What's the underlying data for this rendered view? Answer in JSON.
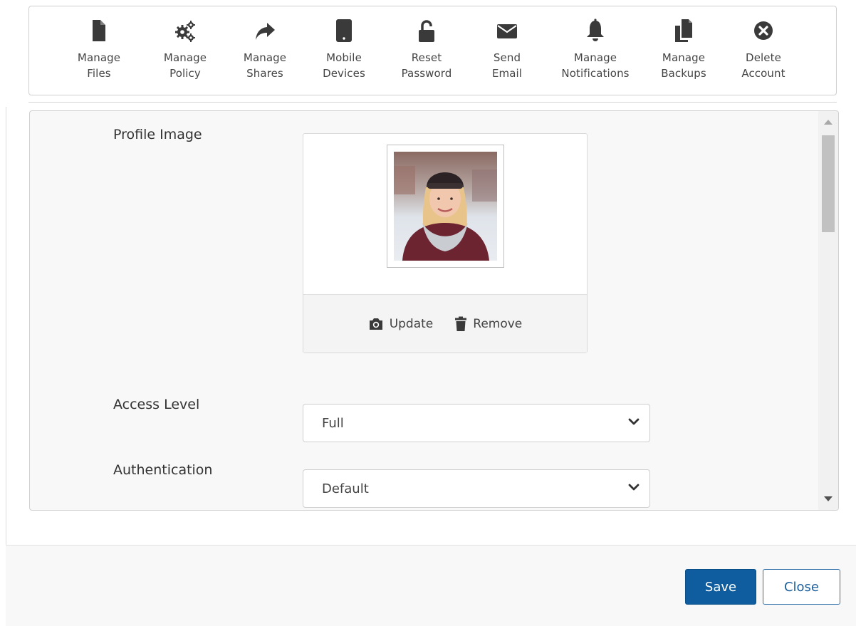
{
  "toolbar": {
    "items": [
      {
        "line1": "Manage",
        "line2": "Files",
        "icon": "file-icon"
      },
      {
        "line1": "Manage",
        "line2": "Policy",
        "icon": "cogs-icon"
      },
      {
        "line1": "Manage",
        "line2": "Shares",
        "icon": "share-arrow-icon"
      },
      {
        "line1": "Mobile",
        "line2": "Devices",
        "icon": "tablet-icon"
      },
      {
        "line1": "Reset",
        "line2": "Password",
        "icon": "unlock-icon"
      },
      {
        "line1": "Send",
        "line2": "Email",
        "icon": "envelope-icon"
      },
      {
        "line1": "Manage",
        "line2": "Notifications",
        "icon": "bell-icon"
      },
      {
        "line1": "Manage",
        "line2": "Backups",
        "icon": "copy-files-icon"
      },
      {
        "line1": "Delete",
        "line2": "Account",
        "icon": "circle-x-icon"
      }
    ]
  },
  "form": {
    "profile_image_label": "Profile Image",
    "update_label": "Update",
    "remove_label": "Remove",
    "access_level_label": "Access Level",
    "access_level_value": "Full",
    "authentication_label": "Authentication",
    "authentication_value": "Default"
  },
  "footer": {
    "save_label": "Save",
    "close_label": "Close"
  },
  "colors": {
    "primary": "#0f5d9e",
    "icon": "#3a3a3a"
  }
}
